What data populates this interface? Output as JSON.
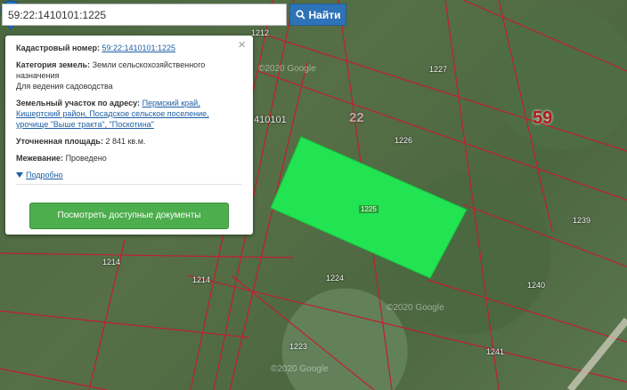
{
  "search": {
    "value": "59:22:1410101:1225",
    "button_label": "Найти"
  },
  "map": {
    "block_label": "59",
    "quarter_label": "22",
    "cadastral_partial": "410101",
    "parcel_labels": [
      "1212",
      "1227",
      "1226",
      "1239",
      "1214",
      "1214",
      "1224",
      "1240",
      "1223",
      "1241",
      "1225"
    ],
    "watermarks": [
      "©2020 Google",
      "©2020 Google",
      "©2020 Google"
    ],
    "colors": {
      "selected_parcel": "#22e352",
      "boundary": "#c0202e",
      "button_blue": "#2e73b8",
      "button_green": "#4cae4c"
    }
  },
  "popup": {
    "cad_number_label": "Кадастровый номер:",
    "cad_number_value": "59:22:1410101:1225",
    "category_label": "Категория земель:",
    "category_value": "Земли сельскохозяйственного назначения",
    "use_value": "Для ведения садоводства",
    "address_label": "Земельный участок по адресу:",
    "address_value": "Пермский край, Кишертский район, Посадское сельское поселение, урочище \"Выше тракта\", \"Поскотина\"",
    "area_label": "Уточненная площадь:",
    "area_value": "2 841 кв.м.",
    "boundary_label": "Межевание:",
    "boundary_value": "Проведено",
    "more_label": "Подробно",
    "docs_button": "Посмотреть доступные документы"
  }
}
